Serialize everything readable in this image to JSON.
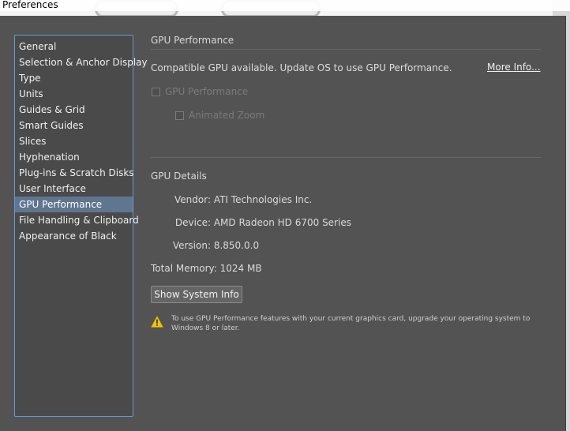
{
  "window": {
    "title": "Preferences"
  },
  "sidebar": {
    "items": [
      {
        "label": "General"
      },
      {
        "label": "Selection & Anchor Display"
      },
      {
        "label": "Type"
      },
      {
        "label": "Units"
      },
      {
        "label": "Guides & Grid"
      },
      {
        "label": "Smart Guides"
      },
      {
        "label": "Slices"
      },
      {
        "label": "Hyphenation"
      },
      {
        "label": "Plug-ins & Scratch Disks"
      },
      {
        "label": "User Interface"
      },
      {
        "label": "GPU Performance"
      },
      {
        "label": "File Handling & Clipboard"
      },
      {
        "label": "Appearance of Black"
      }
    ],
    "selected": "GPU Performance"
  },
  "gpu_performance": {
    "section_title": "GPU Performance",
    "status_text": "Compatible GPU available. Update OS to use GPU Performance.",
    "more_info_link": "More Info...",
    "gpu_checkbox_label": "GPU Performance",
    "gpu_checkbox_checked": false,
    "animated_zoom_label": "Animated Zoom",
    "animated_zoom_checked": false
  },
  "gpu_details": {
    "section_title": "GPU Details",
    "vendor_label": "Vendor:",
    "vendor_value": "ATI Technologies Inc.",
    "device_label": "Device:",
    "device_value": "AMD Radeon HD 6700 Series",
    "version_label": "Version:",
    "version_value": "8.850.0.0",
    "memory_label": "Total Memory:",
    "memory_value": "1024 MB",
    "show_system_info_button": "Show System Info"
  },
  "warning": {
    "icon": "warning-triangle-icon",
    "text": "To use GPU Performance features with your current graphics card, upgrade your operating system to Windows 8 or later."
  },
  "colors": {
    "dialog_background": "#535353",
    "selection_highlight": "#5f7590",
    "sidebar_border": "#5ea0d6",
    "warning_yellow": "#f2c20c"
  }
}
